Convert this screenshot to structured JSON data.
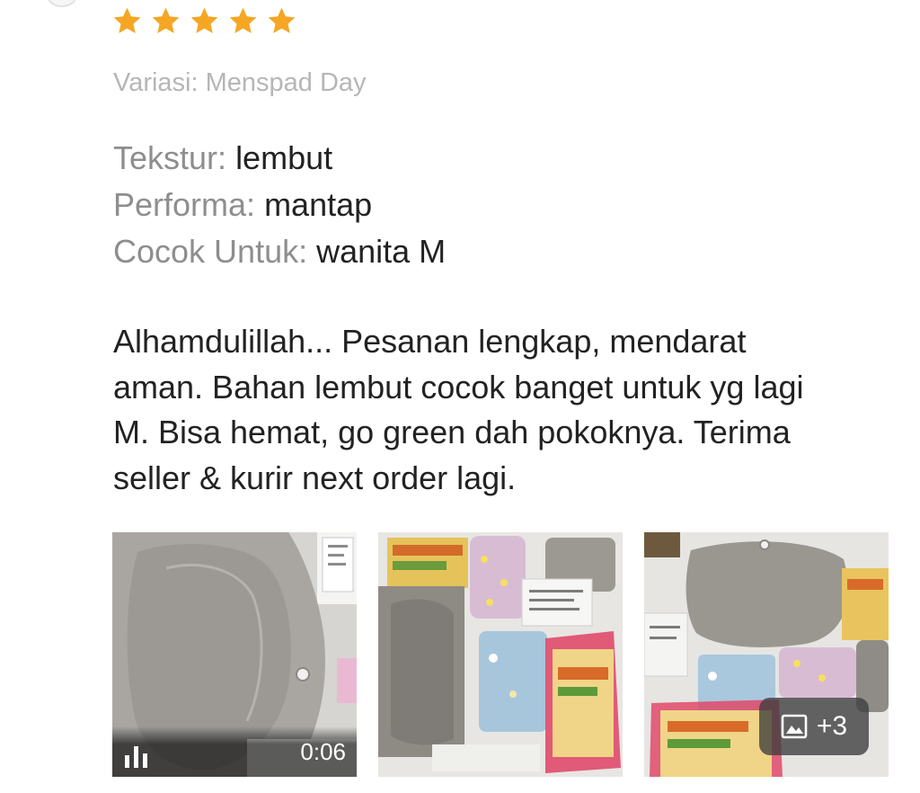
{
  "review": {
    "rating": 5,
    "star_color": "#F5A623",
    "variant": "Variasi: Menspad Day",
    "attributes": [
      {
        "key": "Tekstur:",
        "value": "lembut"
      },
      {
        "key": "Performa:",
        "value": "mantap"
      },
      {
        "key": "Cocok Untuk:",
        "value": "wanita M"
      }
    ],
    "text_lines": [
      "Alhamdulillah... Pesanan lengkap, mendarat",
      "aman. Bahan lembut cocok banget untuk yg lagi",
      "M. Bisa hemat, go green dah pokoknya. Terima",
      "seller & kurir next order lagi."
    ]
  },
  "media": {
    "video": {
      "duration": "0:06",
      "icon": "video-bars-icon"
    },
    "photo_2": {
      "icon": "image-icon"
    },
    "photo_3": {
      "more_count": "+3",
      "icon": "image-icon"
    }
  }
}
